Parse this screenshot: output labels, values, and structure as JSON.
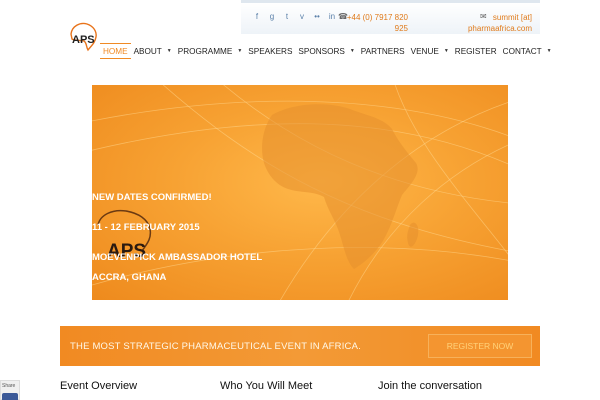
{
  "header": {
    "social_icons": [
      {
        "name": "facebook-icon",
        "glyph": "f"
      },
      {
        "name": "google-plus-icon",
        "glyph": "g"
      },
      {
        "name": "twitter-icon",
        "glyph": "t"
      },
      {
        "name": "vimeo-icon",
        "glyph": "v"
      },
      {
        "name": "flickr-icon",
        "glyph": "••"
      },
      {
        "name": "linkedin-icon",
        "glyph": "in"
      }
    ],
    "phone_glyph": "☎",
    "phone": "+44 (0) 7917 820 925",
    "mail_glyph": "✉",
    "email": "summit [at] pharmaafrica.com"
  },
  "logo": {
    "text": "APS",
    "accent": "#e8731a"
  },
  "nav": {
    "items": [
      {
        "label": "HOME",
        "active": true,
        "dropdown": false
      },
      {
        "label": "ABOUT",
        "dropdown": true
      },
      {
        "label": "PROGRAMME",
        "dropdown": true
      },
      {
        "label": "SPEAKERS",
        "dropdown": false
      },
      {
        "label": "SPONSORS",
        "dropdown": true
      },
      {
        "label": "PARTNERS",
        "dropdown": false
      },
      {
        "label": "VENUE",
        "dropdown": true
      },
      {
        "label": "REGISTER",
        "dropdown": false
      },
      {
        "label": "CONTACT",
        "dropdown": true
      }
    ],
    "caret": "▼"
  },
  "banner": {
    "logo_text": "APS",
    "headline": "NEW DATES CONFIRMED!",
    "dates": "11 - 12 FEBRUARY 2015",
    "venue": "MOEVENPICK AMBASSADOR HOTEL",
    "city": "ACCRA, GHANA"
  },
  "cta": {
    "tagline": "THE MOST STRATEGIC PHARMACEUTICAL EVENT IN AFRICA.",
    "button": "REGISTER NOW"
  },
  "columns": {
    "event_overview": "Event Overview",
    "who_you_will_meet": "Who You Will Meet",
    "join_conversation": "Join the conversation"
  },
  "share": {
    "label": "Share"
  },
  "colors": {
    "accent": "#f08a24",
    "banner_orange": "#f7a233",
    "link_blue": "#5a7fa8"
  }
}
